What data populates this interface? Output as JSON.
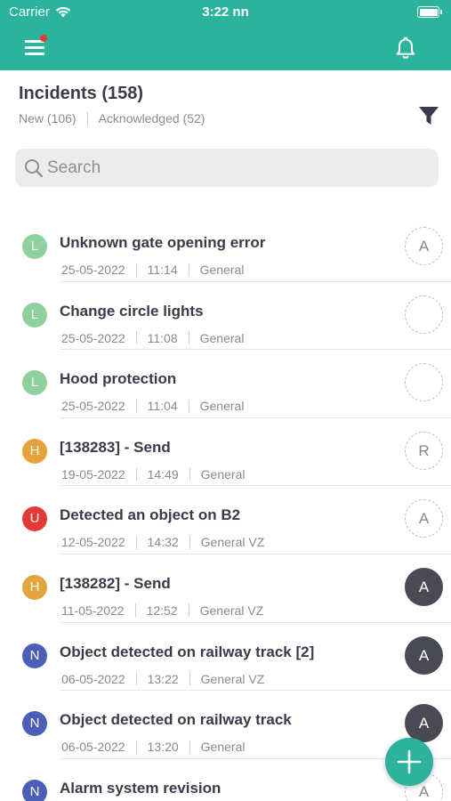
{
  "status_bar": {
    "carrier": "Carrier",
    "time": "3:22 nn",
    "icons": [
      "wifi-icon",
      "battery-icon"
    ]
  },
  "app_bar": {
    "menu_icon": "hamburger-menu-icon",
    "menu_notification_dot": true,
    "bell_icon": "bell-icon"
  },
  "header": {
    "title": "Incidents (158)",
    "tab_new": "New (106)",
    "tab_acknowledged": "Acknowledged (52)",
    "filter_icon": "filter-icon"
  },
  "search": {
    "placeholder": "Search",
    "value": ""
  },
  "incidents": [
    {
      "priority": "L",
      "color": "#8fd19e",
      "title": "Unknown gate opening error",
      "date": "25-05-2022",
      "time": "11:14",
      "category": "General",
      "assignee": "A",
      "assigned": false
    },
    {
      "priority": "L",
      "color": "#8fd19e",
      "title": "Change circle lights",
      "date": "25-05-2022",
      "time": "11:08",
      "category": "General",
      "assignee": "",
      "assigned": false
    },
    {
      "priority": "L",
      "color": "#8fd19e",
      "title": "Hood protection",
      "date": "25-05-2022",
      "time": "11:04",
      "category": "General",
      "assignee": "",
      "assigned": false
    },
    {
      "priority": "H",
      "color": "#e5a43b",
      "title": "[138283] - Send",
      "date": "19-05-2022",
      "time": "14:49",
      "category": "General",
      "assignee": "R",
      "assigned": false
    },
    {
      "priority": "U",
      "color": "#e53935",
      "title": "Detected an object on B2",
      "date": "12-05-2022",
      "time": "14:32",
      "category": "General VZ",
      "assignee": "A",
      "assigned": false
    },
    {
      "priority": "H",
      "color": "#e5a43b",
      "title": "[138282] - Send",
      "date": "11-05-2022",
      "time": "12:52",
      "category": "General VZ",
      "assignee": "A",
      "assigned": true
    },
    {
      "priority": "N",
      "color": "#4a5fb5",
      "title": "Object detected on railway track [2]",
      "date": "06-05-2022",
      "time": "13:22",
      "category": "General VZ",
      "assignee": "A",
      "assigned": true
    },
    {
      "priority": "N",
      "color": "#4a5fb5",
      "title": "Object detected on railway track",
      "date": "06-05-2022",
      "time": "13:20",
      "category": "General",
      "assignee": "A",
      "assigned": true
    },
    {
      "priority": "N",
      "color": "#4a5fb5",
      "title": "Alarm system revision",
      "date": "",
      "time": "",
      "category": "",
      "assignee": "A",
      "assigned": false
    }
  ],
  "fab": {
    "icon": "plus-icon",
    "color": "#2bb39d"
  },
  "colors": {
    "primary": "#2bb39d",
    "title_text": "#3a3a4a",
    "muted_text": "#8a8a8a"
  }
}
